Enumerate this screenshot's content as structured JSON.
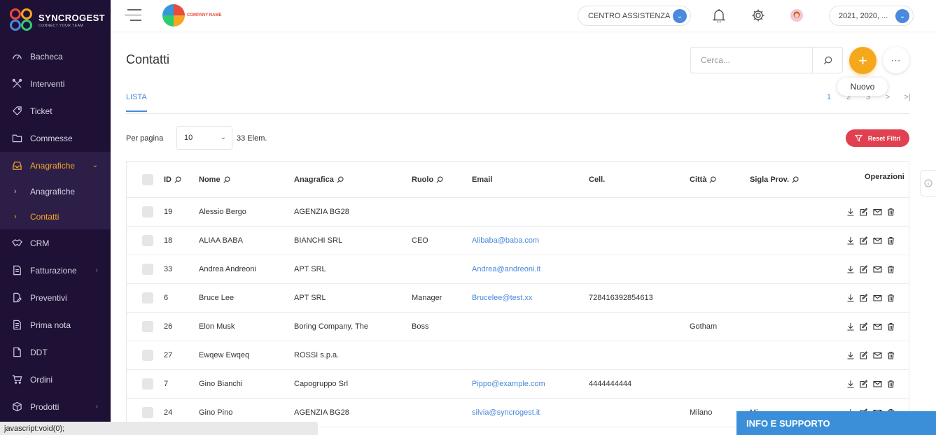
{
  "brand": {
    "title": "SYNCROGEST",
    "subtitle": "CONNECT YOUR TEAM",
    "company_label": "COMPANY NAME"
  },
  "sidebar": {
    "items": [
      {
        "label": "Bacheca",
        "icon": "dashboard-icon"
      },
      {
        "label": "Interventi",
        "icon": "tools-icon"
      },
      {
        "label": "Ticket",
        "icon": "tag-icon"
      },
      {
        "label": "Commesse",
        "icon": "folder-icon"
      },
      {
        "label": "Anagrafiche",
        "icon": "inbox-icon",
        "expanded": true
      },
      {
        "label": "CRM",
        "icon": "handshake-icon"
      },
      {
        "label": "Fatturazione",
        "icon": "invoice-icon"
      },
      {
        "label": "Preventivi",
        "icon": "edit-doc-icon"
      },
      {
        "label": "Prima nota",
        "icon": "notes-icon"
      },
      {
        "label": "DDT",
        "icon": "document-icon"
      },
      {
        "label": "Ordini",
        "icon": "cart-icon"
      },
      {
        "label": "Prodotti",
        "icon": "box-icon"
      }
    ],
    "subitems": [
      {
        "label": "Anagrafiche"
      },
      {
        "label": "Contatti",
        "current": true
      }
    ]
  },
  "topbar": {
    "support_label": "CENTRO ASSISTENZA",
    "years_label": "2021, 2020, ..."
  },
  "main": {
    "title": "Contatti",
    "search_placeholder": "Cerca...",
    "new_tooltip": "Nuovo",
    "tab_label": "LISTA",
    "pager": [
      "1",
      "2",
      "3",
      ">",
      ">|"
    ],
    "per_page_label": "Per pagina",
    "per_page_value": "10",
    "element_count": "33 Elem.",
    "reset_filters_label": "Reset Filtri"
  },
  "table": {
    "columns": {
      "id": "ID",
      "nome": "Nome",
      "anagrafica": "Anagrafica",
      "ruolo": "Ruolo",
      "email": "Email",
      "cell": "Cell.",
      "citta": "Città",
      "sigla": "Sigla Prov.",
      "ops": "Operazioni"
    },
    "rows": [
      {
        "id": "19",
        "nome": "Alessio Bergo",
        "anagrafica": "AGENZIA BG28",
        "ruolo": "",
        "email": "",
        "cell": "",
        "citta": "",
        "sigla": ""
      },
      {
        "id": "18",
        "nome": "ALIAA BABA",
        "anagrafica": "BIANCHI SRL",
        "ruolo": "CEO",
        "email": "Alibaba@baba.com",
        "cell": "",
        "citta": "",
        "sigla": ""
      },
      {
        "id": "33",
        "nome": "Andrea Andreoni",
        "anagrafica": "APT SRL",
        "ruolo": "",
        "email": "Andrea@andreoni.it",
        "cell": "",
        "citta": "",
        "sigla": ""
      },
      {
        "id": "6",
        "nome": "Bruce Lee",
        "anagrafica": "APT SRL",
        "ruolo": "Manager",
        "email": "Brucelee@test.xx",
        "cell": "728416392854613",
        "citta": "",
        "sigla": ""
      },
      {
        "id": "26",
        "nome": "Elon Musk",
        "anagrafica": "Boring Company, The",
        "ruolo": "Boss",
        "email": "",
        "cell": "",
        "citta": "Gotham",
        "sigla": ""
      },
      {
        "id": "27",
        "nome": "Ewqew Ewqeq",
        "anagrafica": "ROSSI s.p.a.",
        "ruolo": "",
        "email": "",
        "cell": "",
        "citta": "",
        "sigla": ""
      },
      {
        "id": "7",
        "nome": "Gino Bianchi",
        "anagrafica": "Capogruppo Srl",
        "ruolo": "",
        "email": "Pippo@example.com",
        "cell": "4444444444",
        "citta": "",
        "sigla": ""
      },
      {
        "id": "24",
        "nome": "Gino Pino",
        "anagrafica": "AGENZIA BG28",
        "ruolo": "",
        "email": "silvia@syncrogest.it",
        "cell": "",
        "citta": "Milano",
        "sigla": "Mi"
      }
    ]
  },
  "status_bar": "javascript:void(0);",
  "info_support_label": "INFO E SUPPORTO",
  "colors": {
    "sidebar_bg": "#1f1135",
    "accent": "#f5a623",
    "link": "#4a89dc",
    "danger": "#e0404f",
    "info": "#3a8fd8"
  }
}
